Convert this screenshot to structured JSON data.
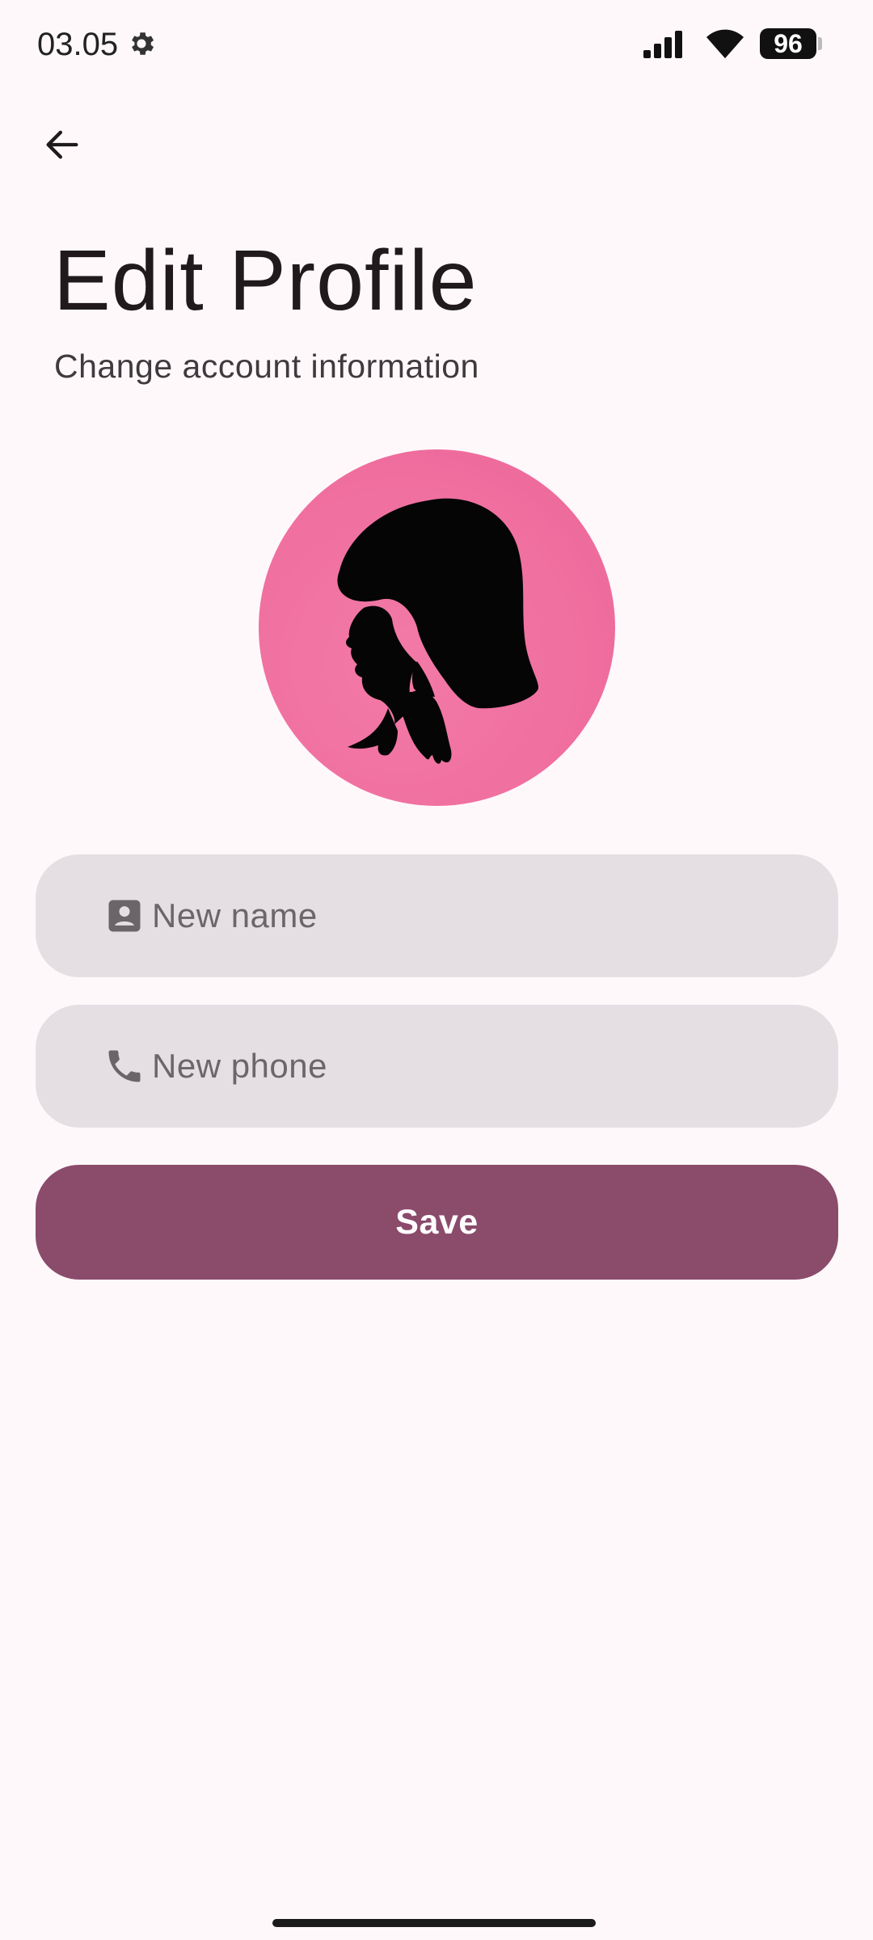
{
  "status_bar": {
    "time": "03.05",
    "battery_level": "96",
    "icons": [
      "gear-icon",
      "signal-icon",
      "wifi-icon",
      "battery-icon"
    ]
  },
  "header": {
    "back_icon": "arrow-left-icon",
    "title": "Edit Profile",
    "subtitle": "Change account information"
  },
  "avatar": {
    "icon": "woman-silhouette-icon",
    "background_color": "#f06f9f"
  },
  "form": {
    "name_field": {
      "icon": "contact-card-icon",
      "placeholder": "New name",
      "value": ""
    },
    "phone_field": {
      "icon": "phone-icon",
      "placeholder": "New phone",
      "value": ""
    },
    "save_label": "Save"
  },
  "colors": {
    "background": "#fff8fb",
    "field_background": "#e5dfe3",
    "primary_button": "#8b4b6b"
  }
}
